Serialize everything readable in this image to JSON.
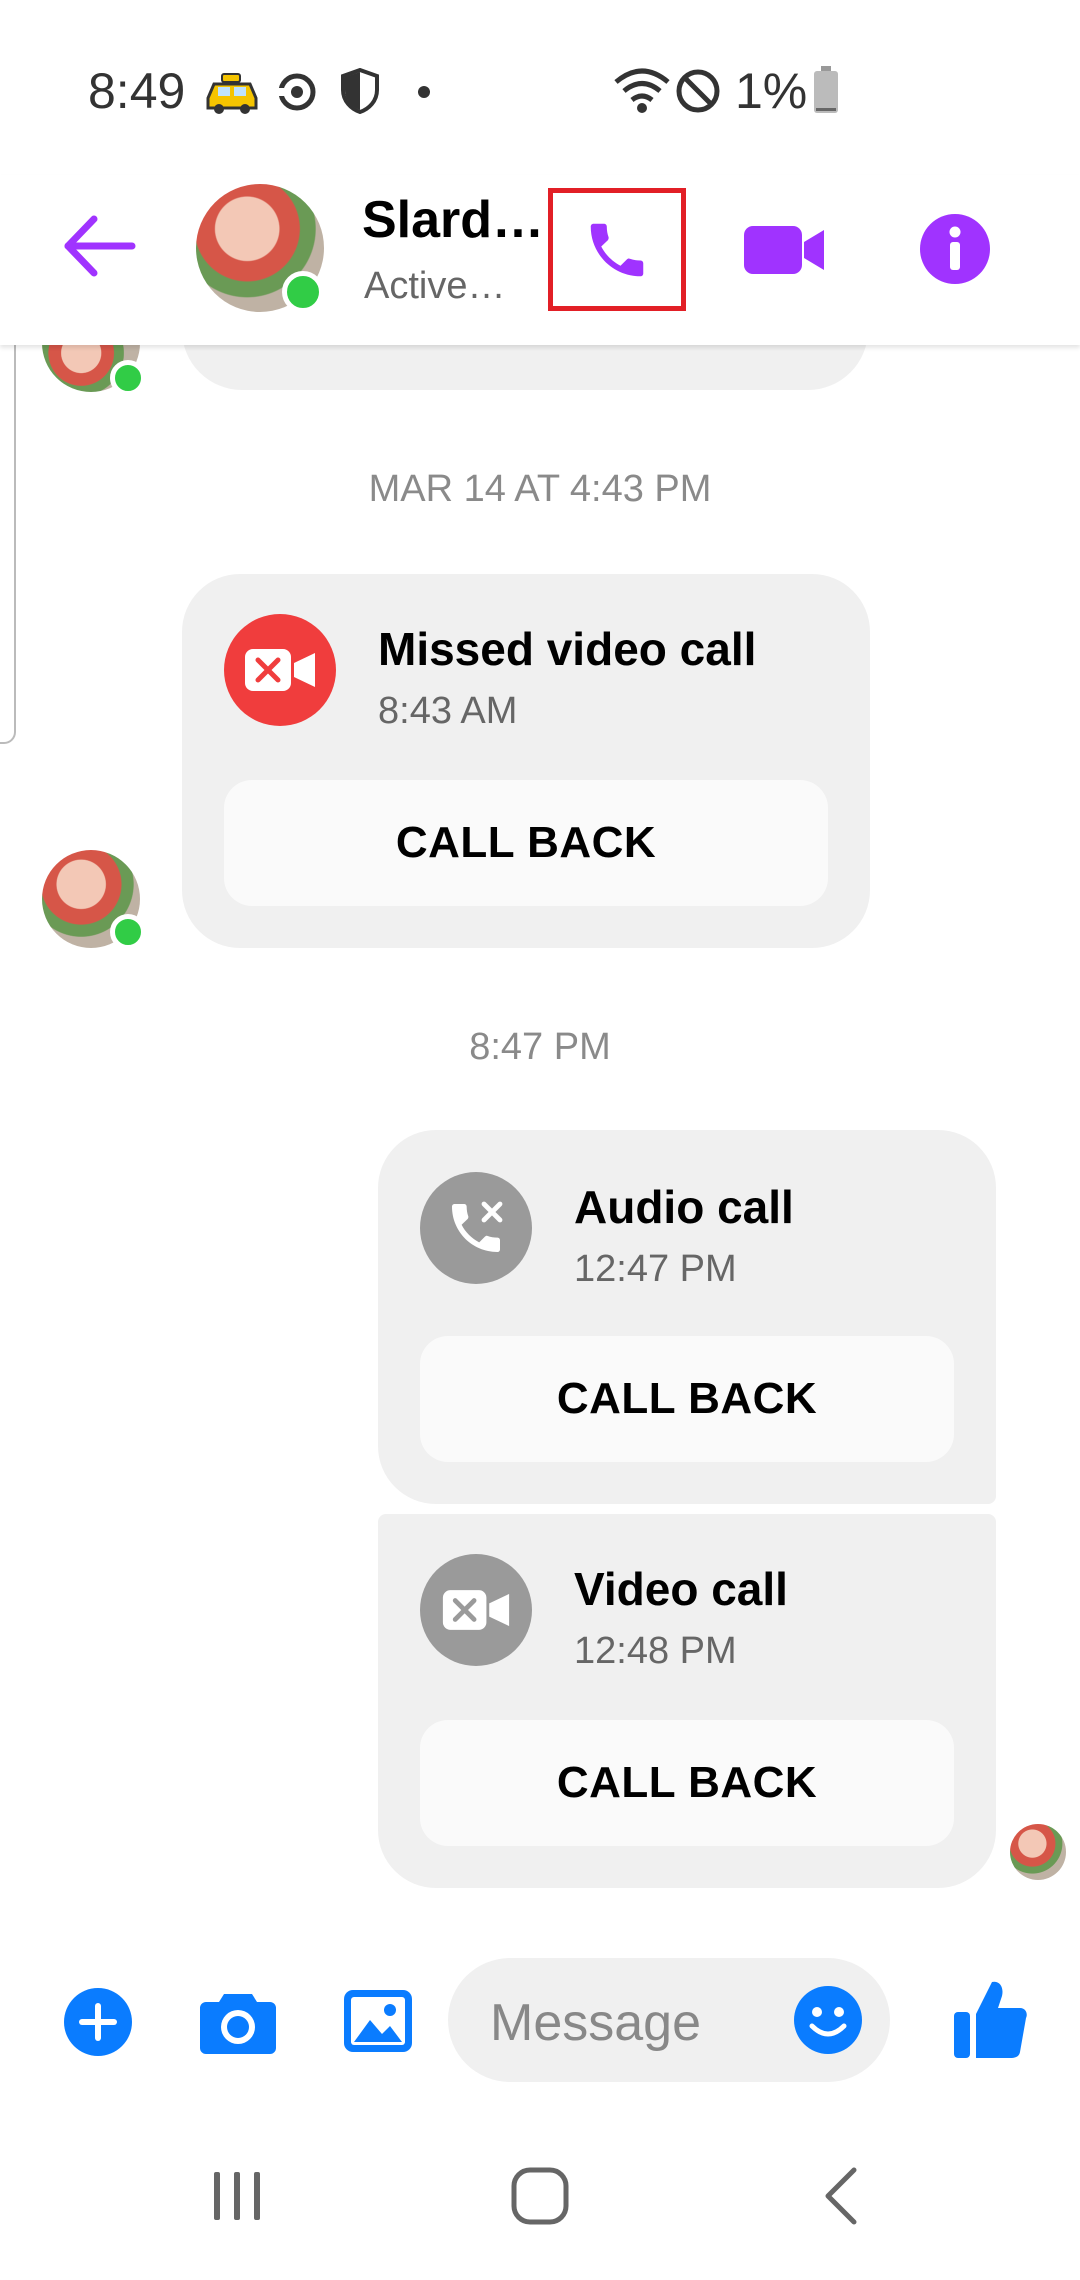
{
  "status_bar": {
    "time": "8:49",
    "battery": "1%"
  },
  "header": {
    "contact_name": "Slard…",
    "contact_status": "Active…"
  },
  "colors": {
    "accent": "#a033ff",
    "messenger_blue": "#0a7cff",
    "missed": "#f03d3d",
    "online": "#31cc46",
    "highlight": "#e21f26"
  },
  "timestamps": [
    "MAR 14 AT 4:43 PM",
    "8:47 PM"
  ],
  "calls": [
    {
      "title": "Missed video call",
      "time": "8:43 AM",
      "button": "CALL BACK",
      "icon": "missed-video-icon"
    },
    {
      "title": "Audio call",
      "time": "12:47 PM",
      "button": "CALL BACK",
      "icon": "phone-missed-icon"
    },
    {
      "title": "Video call",
      "time": "12:48 PM",
      "button": "CALL BACK",
      "icon": "video-missed-icon"
    }
  ],
  "composer": {
    "placeholder": "Message"
  }
}
